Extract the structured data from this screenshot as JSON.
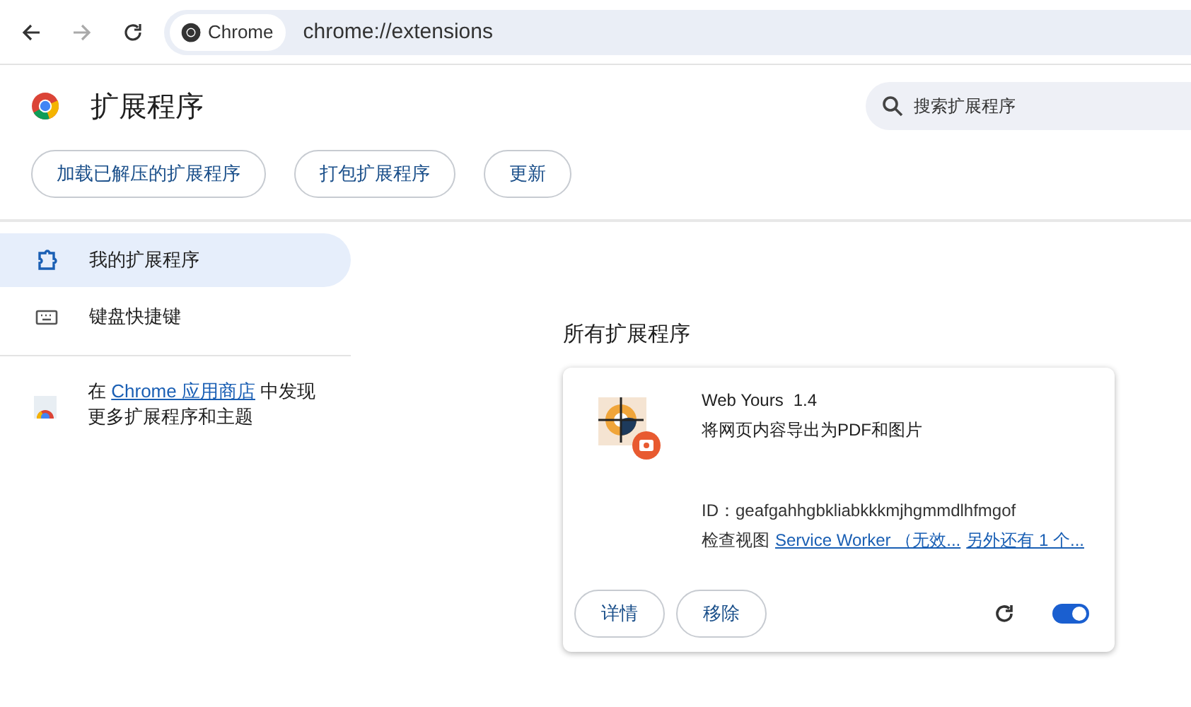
{
  "browser": {
    "back_enabled": true,
    "forward_enabled": false,
    "address_chip": "Chrome",
    "url": "chrome://extensions"
  },
  "header": {
    "title": "扩展程序",
    "search": {
      "placeholder": "搜索扩展程序"
    }
  },
  "toolbar_buttons": [
    "加载已解压的扩展程序",
    "打包扩展程序",
    "更新"
  ],
  "sidebar": {
    "items": [
      {
        "label": "我的扩展程序",
        "kind": "extensions",
        "selected": true
      },
      {
        "label": "键盘快捷键",
        "kind": "keyboard",
        "selected": false
      }
    ],
    "store_note": {
      "before": "在 ",
      "link": "Chrome 应用商店",
      "after": " 中发现更多扩展程序和主题"
    }
  },
  "section_title": "所有扩展程序",
  "extensions": [
    {
      "name": "Web Yours",
      "version": "1.4",
      "description": "将网页内容导出为PDF和图片",
      "id_label": "ID：",
      "id": "geafgahhgbkliabkkkmjhgmmdlhfmgof",
      "inspect_label": "检查视图",
      "inspect_links": [
        "Service Worker （无效...",
        "另外还有 1 个..."
      ],
      "buttons": [
        "详情",
        "移除"
      ],
      "enabled": true
    }
  ]
}
